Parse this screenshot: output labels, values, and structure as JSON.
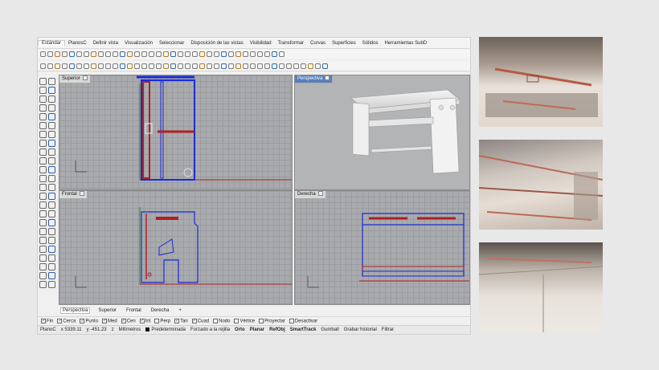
{
  "menu": [
    "Estándar",
    "PlanosC",
    "Definir vista",
    "Visualización",
    "Seleccionar",
    "Disposición de las vistas",
    "Visibilidad",
    "Transformar",
    "Curvas",
    "Superficies",
    "Sólidos",
    "Herramientas SubD"
  ],
  "viewports": {
    "top": {
      "label": "Superior"
    },
    "perspective": {
      "label": "Perspectiva"
    },
    "front": {
      "label": "Frontal"
    },
    "right": {
      "label": "Derecha"
    }
  },
  "view_tabs": [
    "Perspectiva",
    "Superior",
    "Frontal",
    "Derecha"
  ],
  "osnaps": [
    {
      "label": "Fin",
      "checked": true
    },
    {
      "label": "Cerca",
      "checked": true
    },
    {
      "label": "Punto",
      "checked": true
    },
    {
      "label": "Med",
      "checked": true
    },
    {
      "label": "Cen",
      "checked": true
    },
    {
      "label": "Int",
      "checked": true
    },
    {
      "label": "Perp",
      "checked": false
    },
    {
      "label": "Tan",
      "checked": true
    },
    {
      "label": "Cuad",
      "checked": true
    },
    {
      "label": "Nodo",
      "checked": false
    },
    {
      "label": "Vértice",
      "checked": false
    },
    {
      "label": "Proyectar",
      "checked": false
    },
    {
      "label": "Desactivar",
      "checked": false
    }
  ],
  "status": {
    "cplane": "PlanoC",
    "x": "x 5339.11",
    "y": "y -451.23",
    "z": "z",
    "units": "Milímetros",
    "layer": "Predeterminada",
    "toggles": [
      "Forzado a la rejilla",
      "Orto",
      "Planar",
      "RefObj",
      "SmartTrack",
      "Gumball",
      "Grabar historial",
      "Filtrar"
    ]
  },
  "colors": {
    "selection_blue": "#1a2bd6",
    "object_red": "#b02020",
    "active_label": "#5a7fb9"
  }
}
